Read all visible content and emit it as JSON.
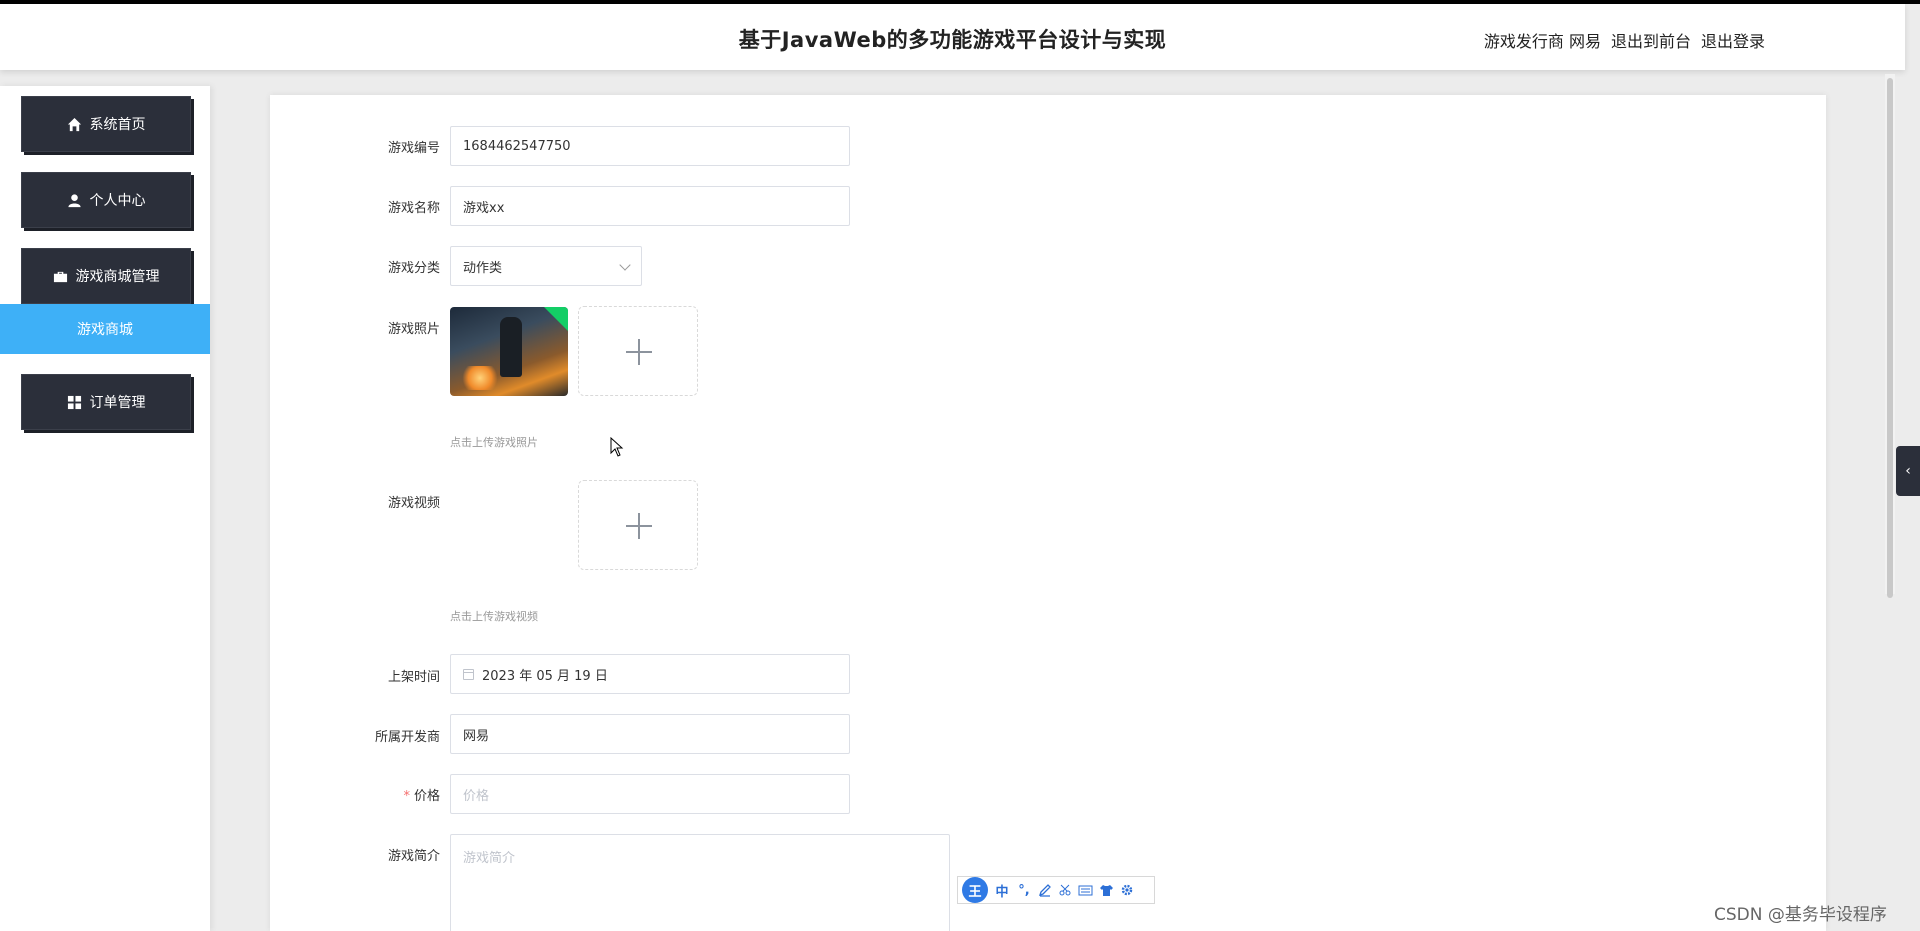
{
  "header": {
    "title": "基于JavaWeb的多功能游戏平台设计与实现",
    "role": "游戏发行商",
    "username": "网易",
    "back_to_front": "退出到前台",
    "logout": "退出登录"
  },
  "sidebar": {
    "items": [
      {
        "label": "系统首页",
        "icon": "home-icon"
      },
      {
        "label": "个人中心",
        "icon": "user-icon"
      },
      {
        "label": "游戏商城管理",
        "icon": "briefcase-icon"
      },
      {
        "label": "订单管理",
        "icon": "grid-icon"
      }
    ],
    "sub_active": "游戏商城"
  },
  "form": {
    "game_no": {
      "label": "游戏编号",
      "value": "1684462547750"
    },
    "game_name": {
      "label": "游戏名称",
      "value": "游戏xx"
    },
    "category": {
      "label": "游戏分类",
      "value": "动作类"
    },
    "photo": {
      "label": "游戏照片",
      "hint": "点击上传游戏照片"
    },
    "video": {
      "label": "游戏视频",
      "hint": "点击上传游戏视频"
    },
    "release_time": {
      "label": "上架时间",
      "value": "2023 年 05 月 19 日"
    },
    "developer": {
      "label": "所属开发商",
      "value": "网易"
    },
    "price": {
      "label": "价格",
      "required_mark": "*",
      "placeholder": "价格"
    },
    "intro": {
      "label": "游戏简介",
      "placeholder": "游戏简介"
    }
  },
  "ime_toolbar": {
    "logo": "王",
    "mode": "中",
    "punct": "°,"
  },
  "side_tab": {
    "glyph": "‹"
  },
  "watermark": "CSDN @基务毕设程序"
}
